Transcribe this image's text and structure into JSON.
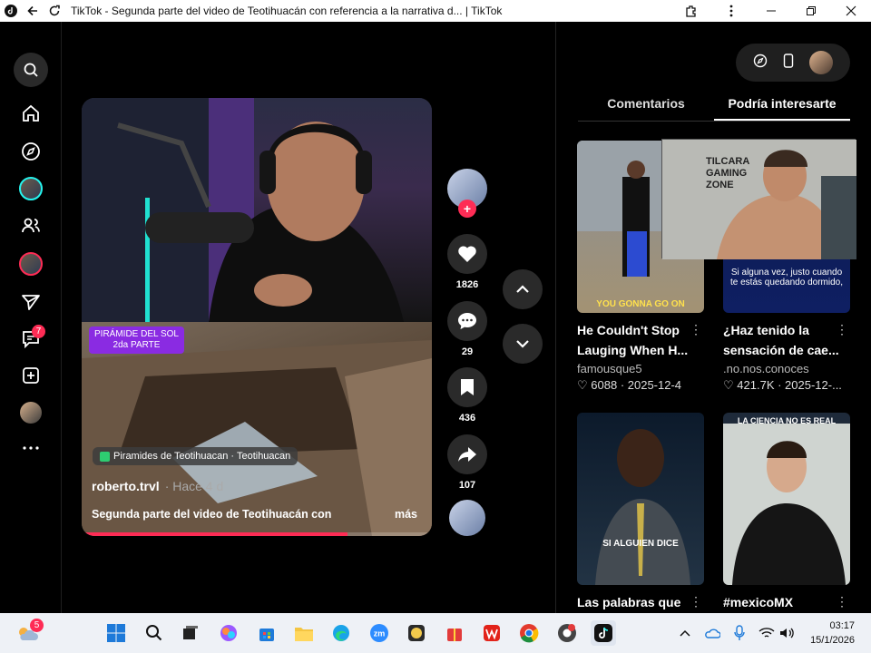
{
  "window": {
    "title": "TikTok - Segunda parte del video de Teotihuacán con referencia a la narrativa d... | TikTok"
  },
  "leftnav": {
    "notification_badge": "7"
  },
  "video": {
    "pyramid_tag_line1": "PIRÁMIDE DEL SOL",
    "pyramid_tag_line2": "2da PARTE",
    "location": "Piramides de Teotihuacan · Teotihuacan",
    "author": "roberto.trvl",
    "ago": "· Hace 4 d",
    "description": "Segunda parte del video de Teotihuacán con",
    "more": "más",
    "progress": 0.76
  },
  "actions": {
    "likes": "1826",
    "comments": "29",
    "saves": "436",
    "shares": "107"
  },
  "right": {
    "tabs": [
      "Comentarios",
      "Podría interesarte"
    ],
    "active_tab": 1,
    "cards": [
      {
        "title": "He Couldn't Stop Lauging When H...",
        "author": "famousque5",
        "likes": "6088",
        "date": "2025-12-4",
        "caption": "YOU GONNA GO ON"
      },
      {
        "title": "¿Haz tenido la sensación de cae...",
        "author": ".no.nos.conoces",
        "likes": "421.7K",
        "date": "2025-12-...",
        "caption": "Si alguna vez, justo cuando te estás quedando dormido,"
      },
      {
        "title": "Las palabras que",
        "author": "",
        "likes": "",
        "date": "",
        "caption": "SI ALGUIEN DICE"
      },
      {
        "title": "#mexicoMX",
        "author": "",
        "likes": "",
        "date": "",
        "caption": "LA CIENCIA NO ES REAL"
      }
    ],
    "overlay_text": "TILCARA GAMING ZONE"
  },
  "taskbar": {
    "weather_badge": "5",
    "time": "03:17",
    "date": "15/1/2026"
  },
  "colors": {
    "accent": "#fe2c55",
    "cyan": "#25f4ee",
    "tag_purple": "#8a2be2"
  }
}
